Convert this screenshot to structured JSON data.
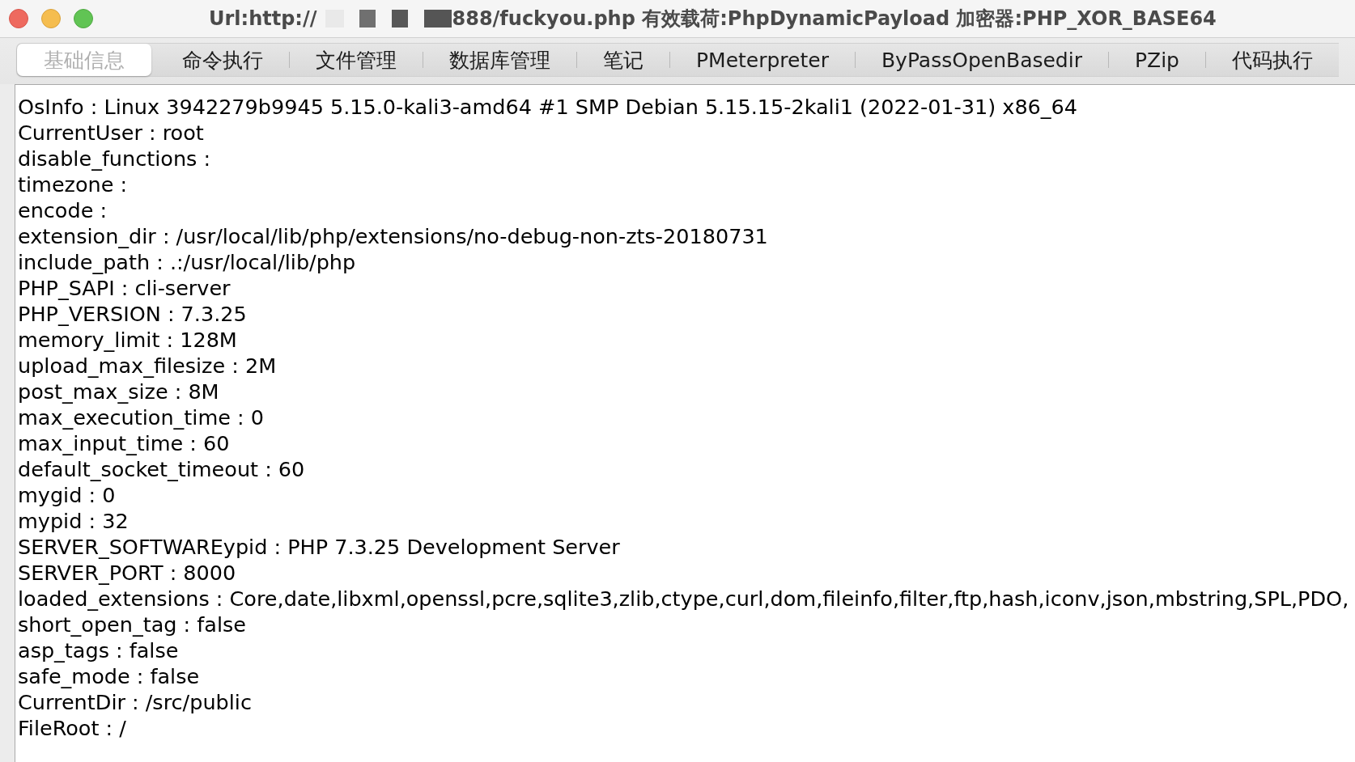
{
  "window": {
    "title_segments": [
      {
        "kind": "text",
        "text": "Url:http://"
      },
      {
        "kind": "redacted"
      },
      {
        "kind": "text",
        "text": "888/fuckyou.php 有效载荷:PhpDynamicPayload 加密器:PHP_XOR_BASE64"
      }
    ]
  },
  "tabs": [
    {
      "label": "基础信息",
      "selected": true
    },
    {
      "label": "命令执行",
      "selected": false
    },
    {
      "label": "文件管理",
      "selected": false
    },
    {
      "label": "数据库管理",
      "selected": false
    },
    {
      "label": "笔记",
      "selected": false
    },
    {
      "label": "PMeterpreter",
      "selected": false
    },
    {
      "label": "ByPassOpenBasedir",
      "selected": false
    },
    {
      "label": "PZip",
      "selected": false
    },
    {
      "label": "代码执行",
      "selected": false
    }
  ],
  "info_lines": [
    "OsInfo : Linux 3942279b9945 5.15.0-kali3-amd64 #1 SMP Debian 5.15.15-2kali1 (2022-01-31) x86_64",
    "CurrentUser : root",
    "disable_functions :",
    "timezone :",
    "encode :",
    "extension_dir : /usr/local/lib/php/extensions/no-debug-non-zts-20180731",
    "include_path : .:/usr/local/lib/php",
    "PHP_SAPI : cli-server",
    "PHP_VERSION : 7.3.25",
    "memory_limit : 128M",
    "upload_max_filesize : 2M",
    "post_max_size : 8M",
    "max_execution_time : 0",
    "max_input_time : 60",
    "default_socket_timeout : 60",
    "mygid : 0",
    "mypid : 32",
    "SERVER_SOFTWAREypid : PHP 7.3.25 Development Server",
    "SERVER_PORT : 8000",
    "loaded_extensions : Core,date,libxml,openssl,pcre,sqlite3,zlib,ctype,curl,dom,fileinfo,filter,ftp,hash,iconv,json,mbstring,SPL,PDO,",
    "short_open_tag : false",
    "asp_tags : false",
    "safe_mode : false",
    "CurrentDir : /src/public",
    "FileRoot : /"
  ]
}
